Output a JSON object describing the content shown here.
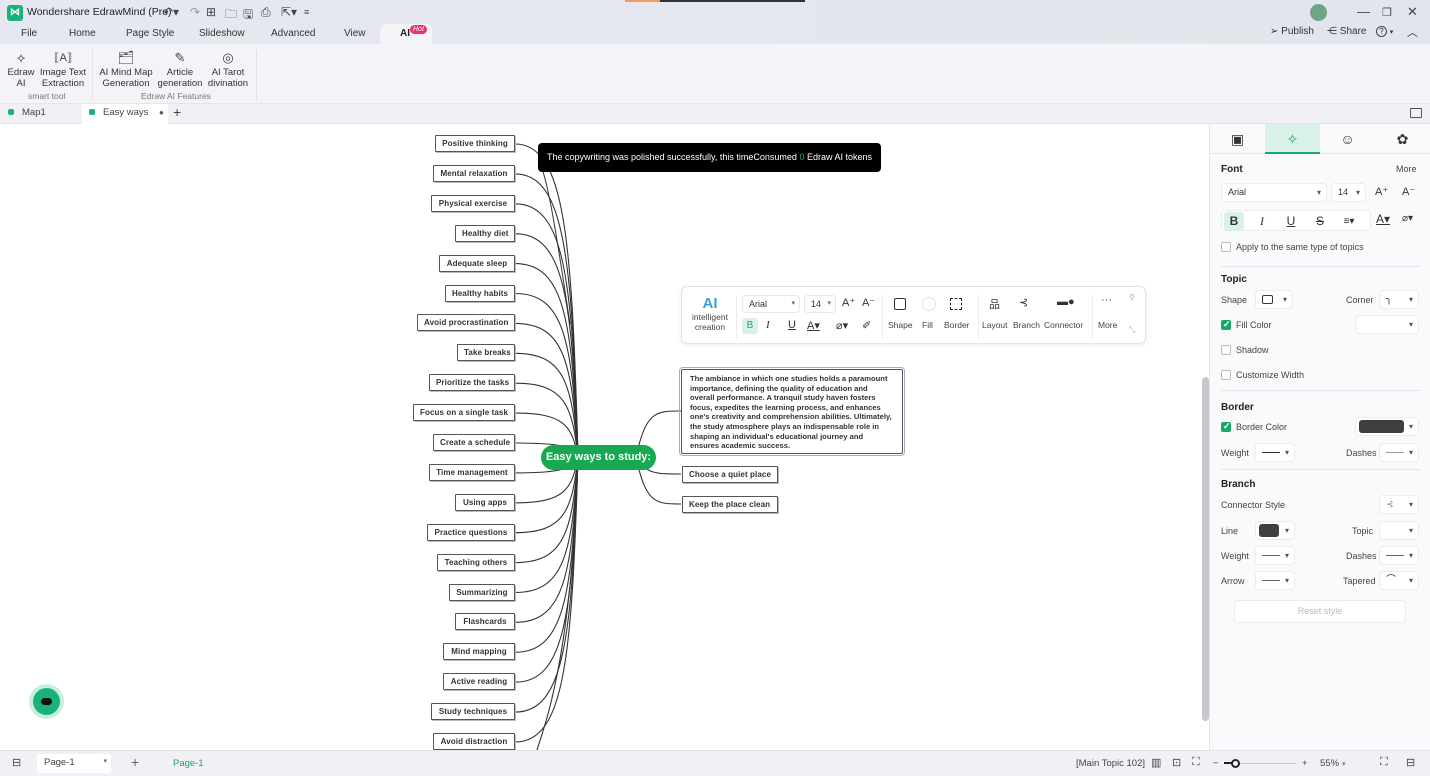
{
  "app": {
    "title": "Wondershare EdrawMind (Pro)",
    "logo_glyph": "⋈",
    "quick_access": [
      {
        "name": "undo-icon",
        "glyph": "↶▾"
      },
      {
        "name": "redo-icon",
        "glyph": "↷"
      },
      {
        "name": "new-icon",
        "glyph": "⊞"
      },
      {
        "name": "open-folder-icon",
        "glyph": "🗀"
      },
      {
        "name": "save-icon",
        "glyph": "🖫"
      },
      {
        "name": "print-icon",
        "glyph": "⎙"
      },
      {
        "name": "export-icon",
        "glyph": "⇱▾"
      },
      {
        "name": "customize-icon",
        "glyph": "≡"
      }
    ]
  },
  "menu": {
    "items": [
      "File",
      "Home",
      "Page Style",
      "Slideshow",
      "Advanced",
      "View"
    ],
    "ai_tab": "AI",
    "hot_badge": "Hot"
  },
  "topright": {
    "publish": "Publish",
    "share": "Share",
    "help": "?"
  },
  "window": {
    "minimize": "—",
    "restore": "❐",
    "close": "✕",
    "collapse": "︿"
  },
  "ribbon": {
    "buttons": [
      {
        "label1": "Edraw",
        "label2": "AI",
        "icon": "⟡"
      },
      {
        "label1": "Image Text",
        "label2": "Extraction",
        "icon": "⟦A⟧"
      },
      {
        "label1": "AI Mind Map",
        "label2": "Generation",
        "icon": "🗂"
      },
      {
        "label1": "Article",
        "label2": "generation",
        "icon": "✎"
      },
      {
        "label1": "AI Tarot",
        "label2": "divination",
        "icon": "◎"
      }
    ],
    "groups": [
      "smart tool",
      "Edraw AI Features"
    ]
  },
  "doc_tabs": {
    "tabs": [
      "Map1",
      "Easy ways"
    ],
    "modified_dot": "●",
    "add": "+"
  },
  "toast": {
    "before": "The copywriting was polished successfully, this timeConsumed ",
    "count": "0",
    "after": " Edraw AI tokens"
  },
  "mindmap": {
    "central": "Easy ways to study:",
    "left_topics": [
      "Positive thinking",
      "Mental relaxation",
      "Physical exercise",
      "Healthy diet",
      "Adequate sleep",
      "Healthy habits",
      "Avoid procrastination",
      "Take breaks",
      "Prioritize the tasks",
      "Focus on a single task",
      "Create a schedule",
      "Time management",
      "Using apps",
      "Practice questions",
      "Teaching others",
      "Summarizing",
      "Flashcards",
      "Mind mapping",
      "Active reading",
      "Study techniques",
      "Avoid distraction"
    ],
    "right_paragraph": "The ambiance in which one studies holds a paramount importance, defining the quality of education and overall performance. A tranquil study haven fosters focus, expedites the learning process, and enhances one's creativity and comprehension abilities. Ultimately, the study atmosphere plays an indispensable role in shaping an individual's educational journey and ensures academic success.",
    "right_topics": [
      "Choose a quiet place",
      "Keep the place clean"
    ]
  },
  "floating_toolbar": {
    "ai_big": "AI",
    "ai_label1": "intelligent",
    "ai_label2": "creation",
    "font": "Arial",
    "size": "14",
    "labels": [
      "Shape",
      "Fill",
      "Border",
      "Layout",
      "Branch",
      "Connector",
      "More"
    ]
  },
  "panel": {
    "font": {
      "title": "Font",
      "more": "More",
      "family": "Arial",
      "size": "14",
      "apply_same": "Apply to the same type of topics"
    },
    "topic": {
      "title": "Topic",
      "shape": "Shape",
      "corner": "Corner",
      "fill_color": "Fill Color",
      "fill_checked": true,
      "shadow": "Shadow",
      "shadow_checked": false,
      "customize_width": "Customize Width",
      "customize_checked": false
    },
    "border": {
      "title": "Border",
      "border_color": "Border Color",
      "border_checked": true,
      "color": "#3f3f3f",
      "weight": "Weight",
      "dashes": "Dashes"
    },
    "branch": {
      "title": "Branch",
      "connector_style": "Connector Style",
      "line": "Line",
      "line_color": "#3f3f3f",
      "topic": "Topic",
      "weight": "Weight",
      "dashes": "Dashes",
      "arrow": "Arrow",
      "tapered": "Tapered"
    },
    "reset": "Reset style"
  },
  "status": {
    "page_select": "Page-1",
    "add": "+",
    "active_page": "Page-1",
    "selection": "[Main Topic 102]",
    "zoom_minus": "−",
    "zoom_plus": "+",
    "zoom_percent": "55%",
    "zoom_level": 0.55
  },
  "colors": {
    "accent": "#19a868",
    "central_fill": "#16a952",
    "hot_badge": "#e8336d",
    "ai_blue": "#3aa0d8"
  }
}
